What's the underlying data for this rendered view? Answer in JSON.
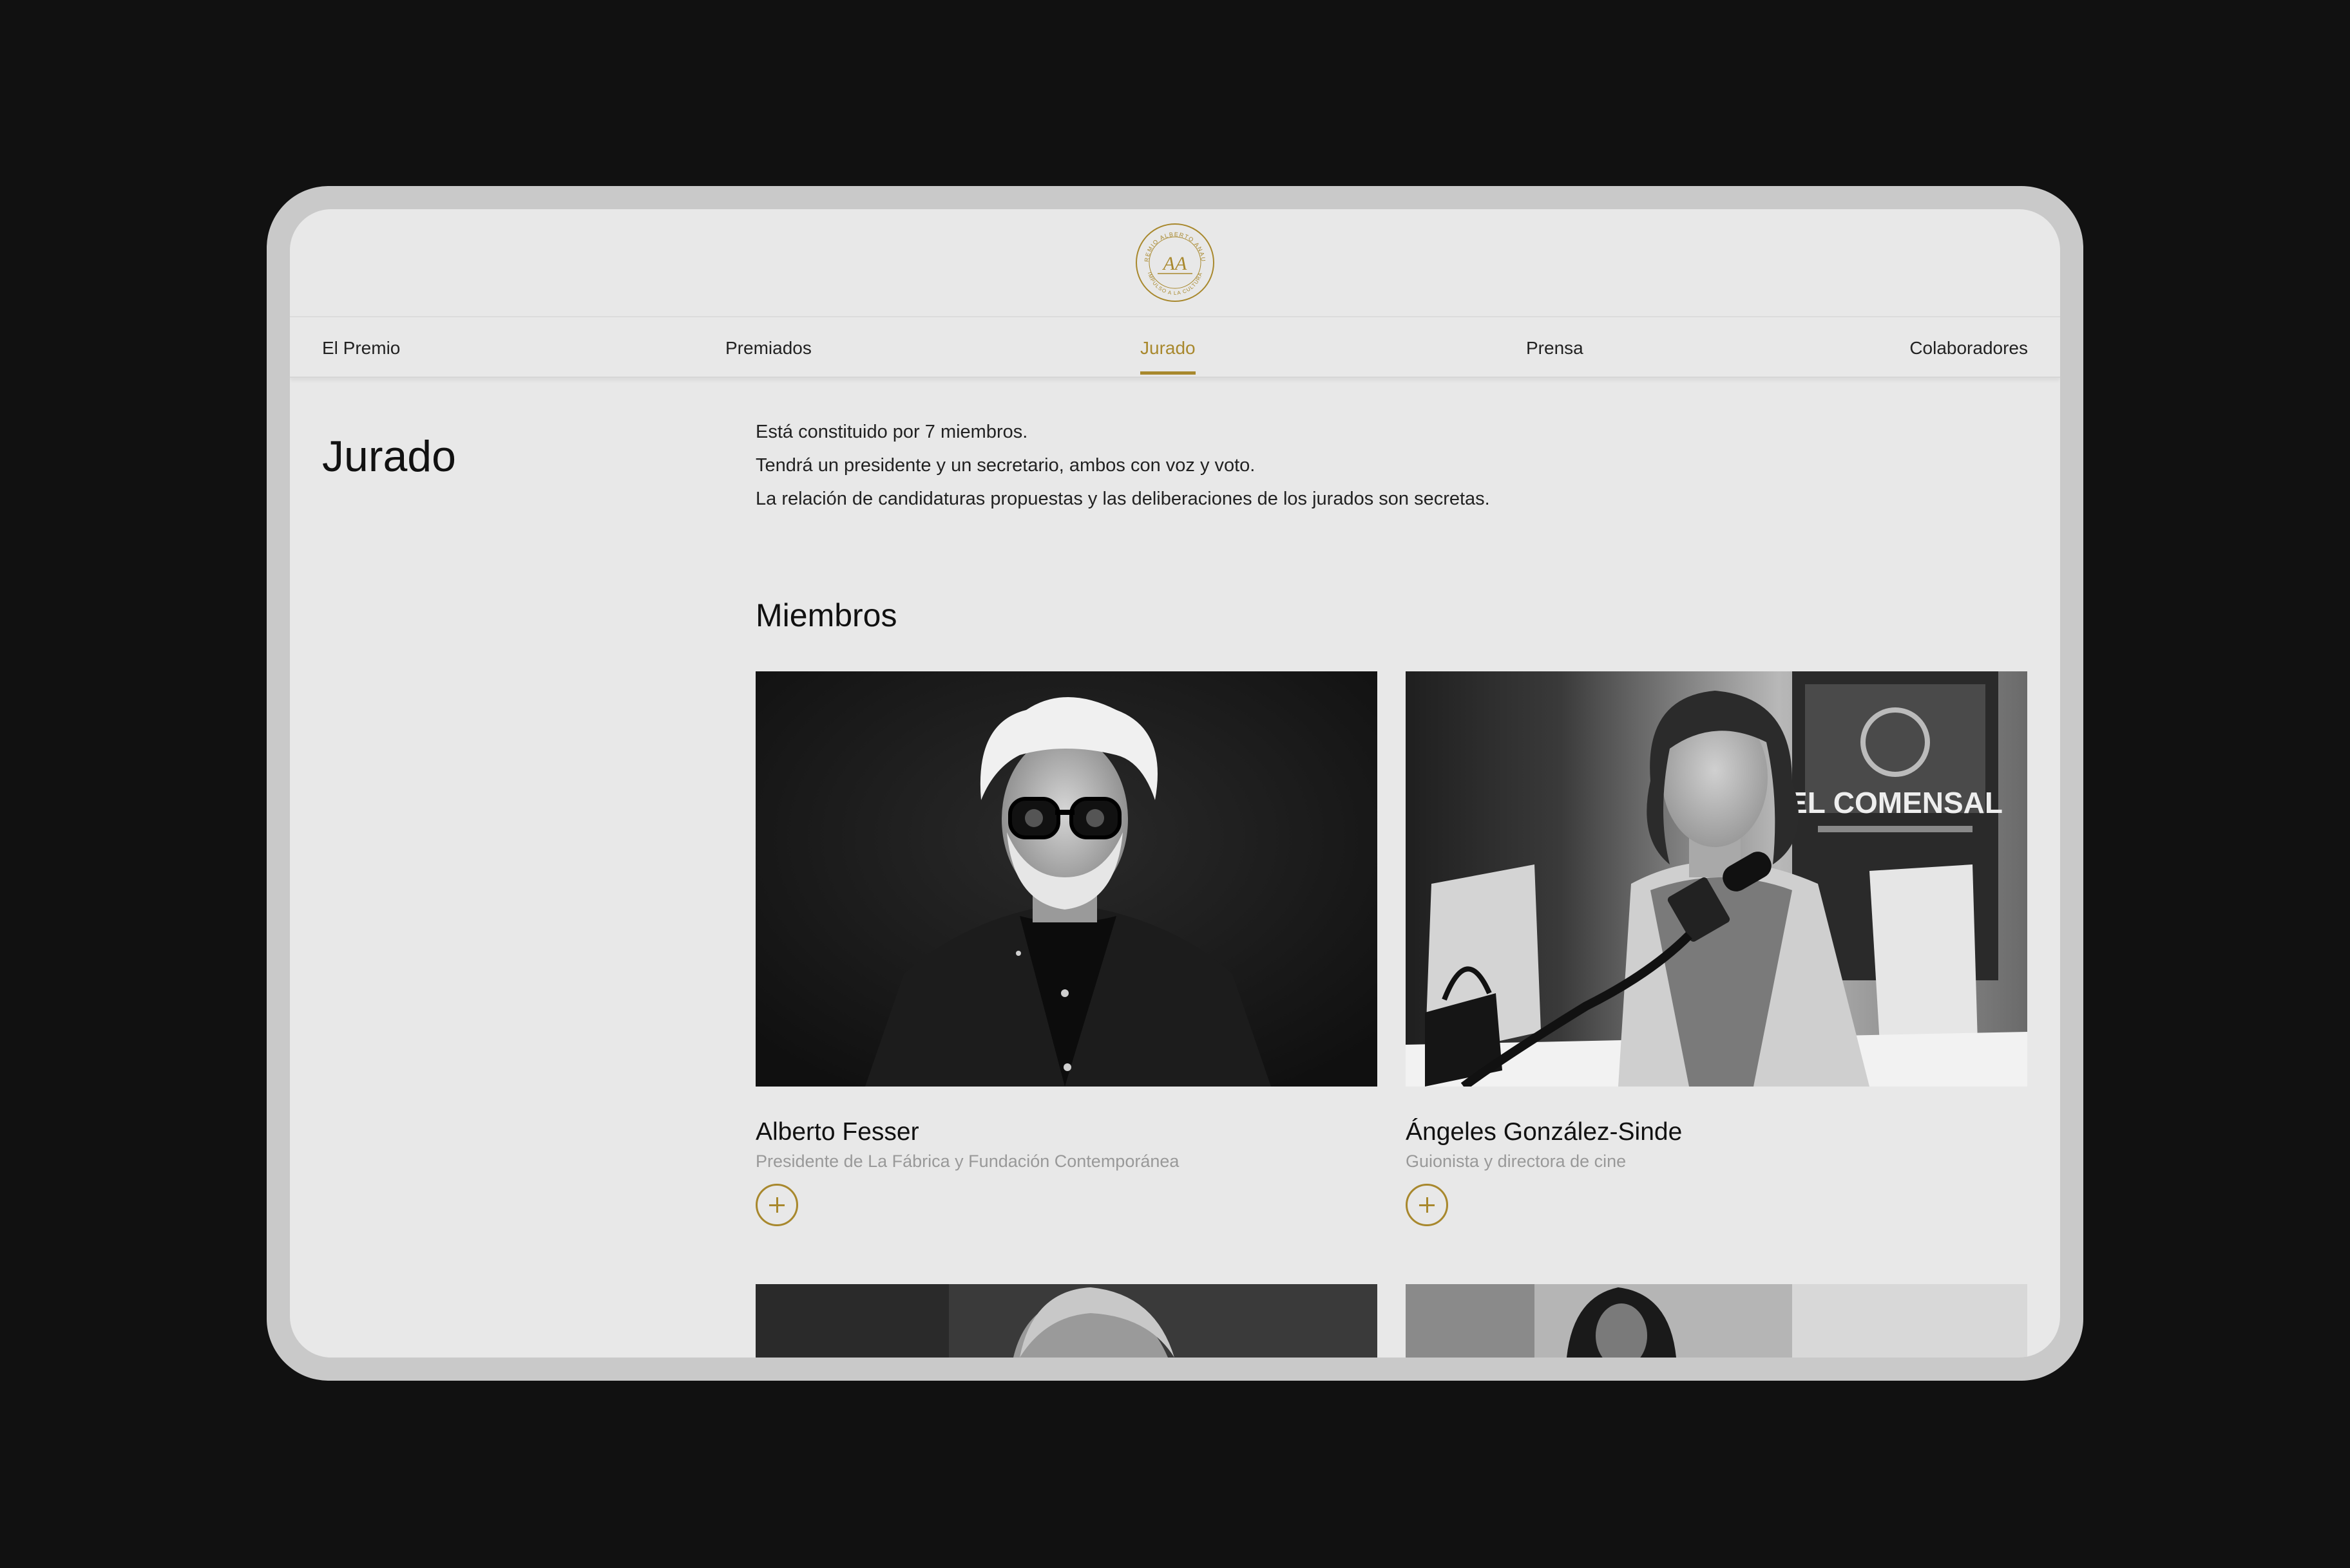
{
  "brand": {
    "logo_ring_text_top": "PREMIO ALBERTO ANAUT",
    "logo_ring_text_bottom": "IMPULSO A LA CULTURA",
    "logo_monogram": "AA",
    "accent_color": "#a8882d"
  },
  "nav": {
    "items": [
      {
        "label": "El Premio",
        "active": false
      },
      {
        "label": "Premiados",
        "active": false
      },
      {
        "label": "Jurado",
        "active": true
      },
      {
        "label": "Prensa",
        "active": false
      },
      {
        "label": "Colaboradores",
        "active": false
      }
    ]
  },
  "page": {
    "title": "Jurado",
    "intro": [
      "Está constituido por 7 miembros.",
      "Tendrá un presidente y un secretario, ambos con voz y voto.",
      "La relación de candidaturas propuestas y las deliberaciones de los jurados son secretas."
    ]
  },
  "members": {
    "title": "Miembros",
    "cards": [
      {
        "name": "Alberto Fesser",
        "role": "Presidente de La Fábrica y Fundación Contemporánea",
        "icon": "plus-icon"
      },
      {
        "name": "Ángeles González-Sinde",
        "role": "Guionista y directora de cine",
        "icon": "plus-icon"
      }
    ],
    "poster_text": "EL COMENSAL"
  }
}
